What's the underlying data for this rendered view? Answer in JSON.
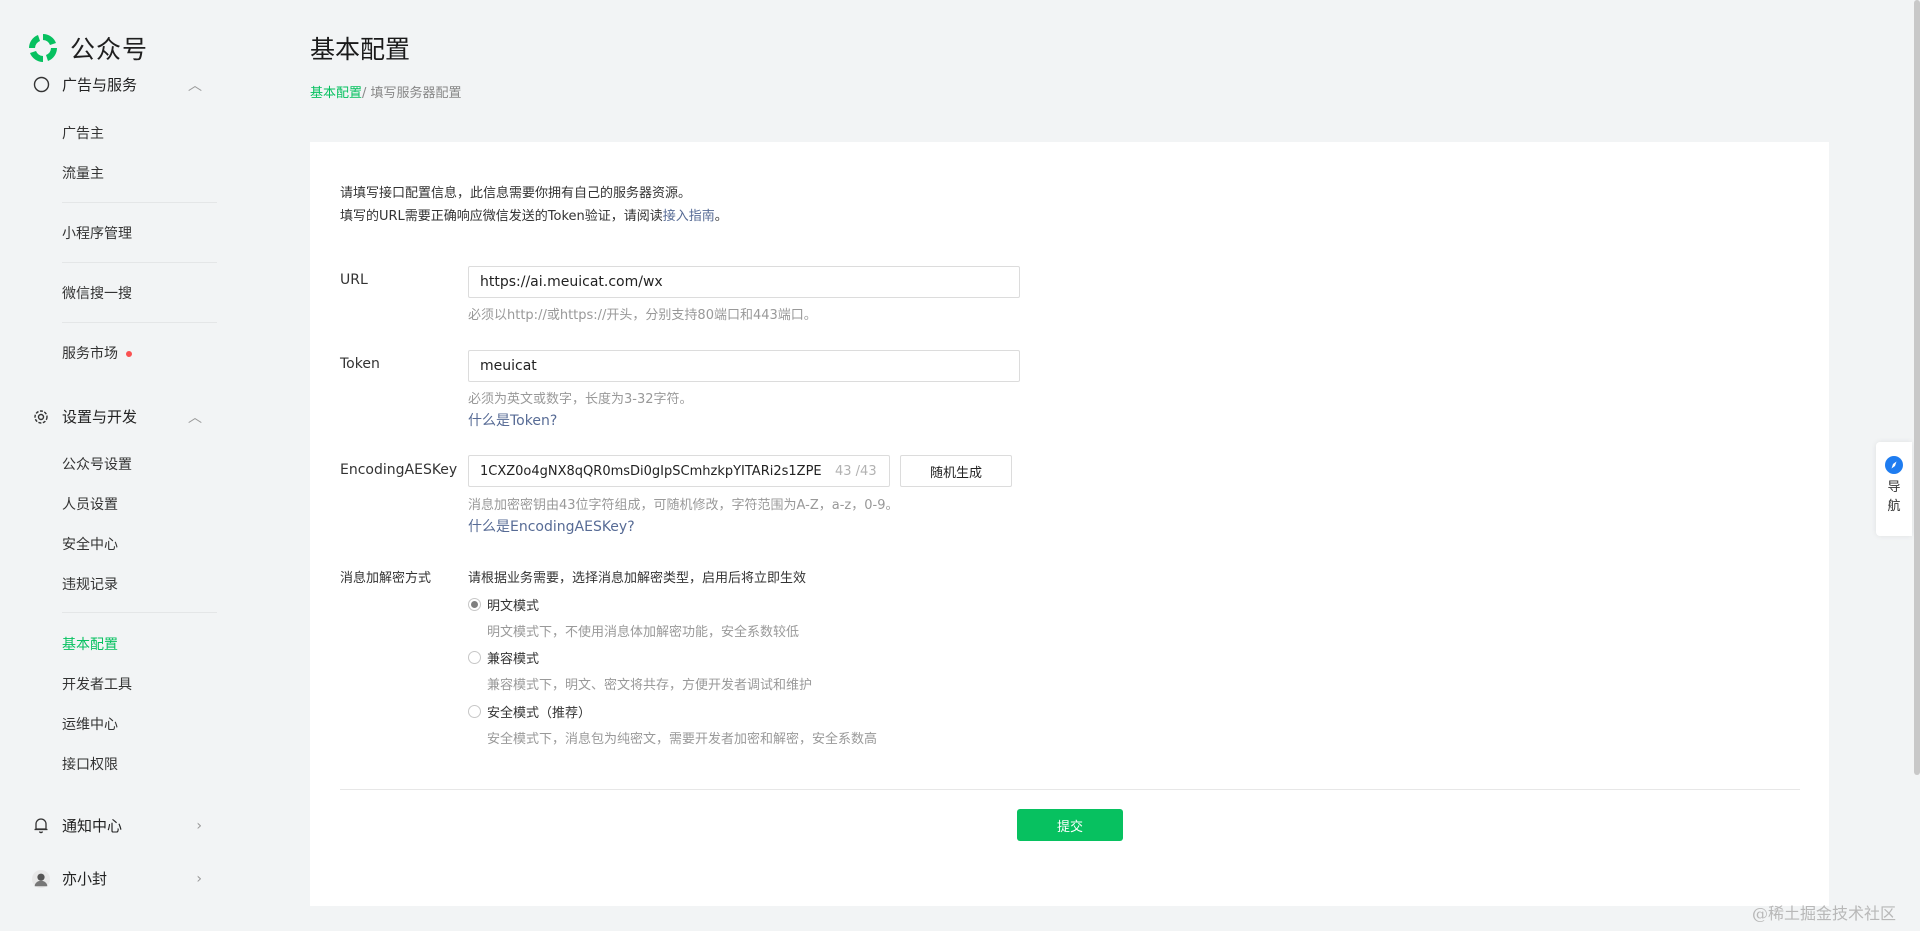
{
  "brand": {
    "name": "公众号"
  },
  "sidebar": {
    "partial_group": "广告与服务",
    "ad_items": [
      "广告主",
      "流量主"
    ],
    "mini_program": "小程序管理",
    "wechat_search": "微信搜一搜",
    "service_market": "服务市场",
    "settings_group": "设置与开发",
    "settings_items": [
      "公众号设置",
      "人员设置",
      "安全中心",
      "违规记录"
    ],
    "dev_items": [
      "基本配置",
      "开发者工具",
      "运维中心",
      "接口权限"
    ],
    "notice_center": "通知中心",
    "user_name": "亦小封"
  },
  "main": {
    "title": "基本配置",
    "breadcrumb": {
      "link": "基本配置",
      "current": "/ 填写服务器配置"
    },
    "intro_line1": "请填写接口配置信息，此信息需要你拥有自己的服务器资源。",
    "intro_line2_prefix": "填写的URL需要正确响应微信发送的Token验证，请阅读",
    "intro_link": "接入指南",
    "intro_line2_suffix": "。",
    "url": {
      "label": "URL",
      "value": "https://ai.meuicat.com/wx",
      "hint": "必须以http://或https://开头，分别支持80端口和443端口。"
    },
    "token": {
      "label": "Token",
      "value": "meuicat",
      "hint": "必须为英文或数字，长度为3-32字符。",
      "help": "什么是Token?"
    },
    "aes": {
      "label": "EncodingAESKey",
      "value": "1CXZ0o4gNX8qQR0msDi0gIpSCmhzkpYITARi2s1ZPE",
      "count": "43 /43",
      "random_button": "随机生成",
      "hint": "消息加密密钥由43位字符组成，可随机修改，字符范围为A-Z，a-z，0-9。",
      "help": "什么是EncodingAESKey?"
    },
    "encryption": {
      "label": "消息加解密方式",
      "description": "请根据业务需要，选择消息加解密类型，启用后将立即生效",
      "options": [
        {
          "label": "明文模式",
          "desc": "明文模式下，不使用消息体加解密功能，安全系数较低"
        },
        {
          "label": "兼容模式",
          "desc": "兼容模式下，明文、密文将共存，方便开发者调试和维护"
        },
        {
          "label": "安全模式（推荐）",
          "desc": "安全模式下，消息包为纯密文，需要开发者加密和解密，安全系数高"
        }
      ]
    },
    "submit": "提交"
  },
  "float_nav": {
    "text_top": "导",
    "text_bottom": "航"
  },
  "watermark": "@稀土掘金技术社区",
  "colors": {
    "accent": "#07c160",
    "link": "#576b95",
    "background": "#f2f4f5"
  }
}
